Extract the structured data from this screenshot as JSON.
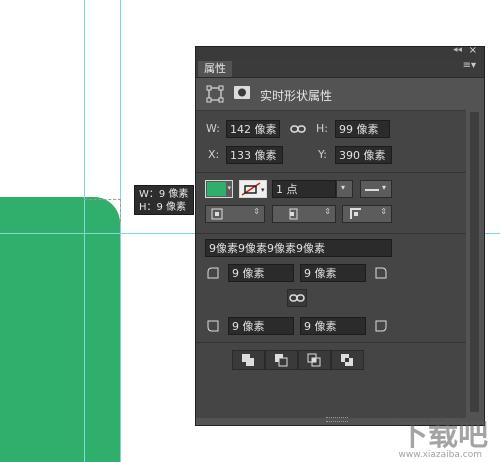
{
  "panel": {
    "tab_label": "属性",
    "section_title": "实时形状属性",
    "collapse_glyph": "◂◂",
    "close_glyph": "×",
    "menu_glyph": "≡▾"
  },
  "transform": {
    "w_label": "W:",
    "w_value": "142 像素",
    "h_label": "H:",
    "h_value": "99 像素",
    "x_label": "X:",
    "x_value": "133 像素",
    "y_label": "Y:",
    "y_value": "390 像素"
  },
  "stroke": {
    "fill_color": "#2faf6b",
    "stroke_width_value": "1 点"
  },
  "corners": {
    "combined_value": "9像素9像素9像素9像素",
    "top_left": "9 像素",
    "top_right": "9 像素",
    "bottom_left": "9 像素",
    "bottom_right": "9 像素"
  },
  "tooltip": {
    "w_line": "W：9 像素",
    "h_line": "H：9 像素"
  },
  "canvas": {
    "shape_color": "#2faf6b",
    "guide_color": "#7fd8d8"
  },
  "watermark": {
    "text": "下载吧",
    "url": "www.xiazaiba.com"
  }
}
